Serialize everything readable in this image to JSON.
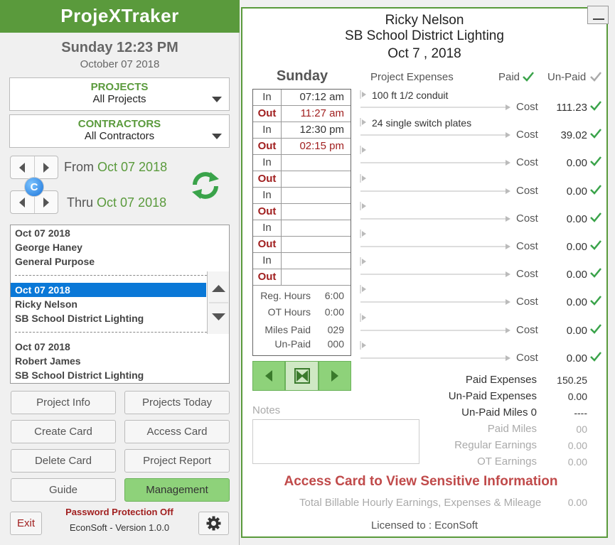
{
  "app": {
    "title": "ProjeXTraker"
  },
  "now": {
    "day_time": "Sunday 12:23 PM",
    "date": "October 07 2018"
  },
  "filters": {
    "projects_label": "PROJECTS",
    "projects_value": "All Projects",
    "contractors_label": "CONTRACTORS",
    "contractors_value": "All Contractors"
  },
  "range": {
    "from_label": "From",
    "from_date": "Oct 07 2018",
    "thru_label": "Thru",
    "thru_date": "Oct 07 2018",
    "clear_badge": "C"
  },
  "cards": [
    {
      "date": "Oct 07 2018",
      "name": "George Haney",
      "project": "General Purpose",
      "selected": false
    },
    {
      "date": "Oct 07 2018",
      "name": "Ricky Nelson",
      "project": "SB School District Lighting",
      "selected": true
    },
    {
      "date": "Oct 07 2018",
      "name": "Robert James",
      "project": "SB School District Lighting",
      "selected": false
    }
  ],
  "buttons": {
    "project_info": "Project Info",
    "projects_today": "Projects Today",
    "create_card": "Create Card",
    "access_card": "Access Card",
    "delete_card": "Delete Card",
    "project_report": "Project Report",
    "guide": "Guide",
    "management": "Management",
    "exit": "Exit"
  },
  "footer": {
    "password_status": "Password Protection Off",
    "version": "EconSoft - Version 1.0.0"
  },
  "card": {
    "name": "Ricky Nelson",
    "project": "SB School District Lighting",
    "date": "Oct 7 , 2018",
    "day": "Sunday",
    "times": [
      {
        "label": "In",
        "value": "07:12 am"
      },
      {
        "label": "Out",
        "value": "11:27 am"
      },
      {
        "label": "In",
        "value": "12:30 pm"
      },
      {
        "label": "Out",
        "value": "02:15 pm"
      },
      {
        "label": "In",
        "value": ""
      },
      {
        "label": "Out",
        "value": ""
      },
      {
        "label": "In",
        "value": ""
      },
      {
        "label": "Out",
        "value": ""
      },
      {
        "label": "In",
        "value": ""
      },
      {
        "label": "Out",
        "value": ""
      },
      {
        "label": "In",
        "value": ""
      },
      {
        "label": "Out",
        "value": ""
      }
    ],
    "hours": {
      "reg_label": "Reg. Hours",
      "reg_value": "6:00",
      "ot_label": "OT Hours",
      "ot_value": "0:00",
      "miles_paid_label": "Miles Paid",
      "miles_paid_value": "029",
      "miles_unpaid_label": "Un-Paid",
      "miles_unpaid_value": "000"
    },
    "expenses_header": {
      "title": "Project Expenses",
      "paid": "Paid",
      "unpaid": "Un-Paid"
    },
    "expenses": [
      {
        "desc": "100 ft 1/2 conduit",
        "cost_label": "Cost",
        "cost": "111.23"
      },
      {
        "desc": "24 single switch plates",
        "cost_label": "Cost",
        "cost": "39.02"
      },
      {
        "desc": "",
        "cost_label": "Cost",
        "cost": "0.00"
      },
      {
        "desc": "",
        "cost_label": "Cost",
        "cost": "0.00"
      },
      {
        "desc": "",
        "cost_label": "Cost",
        "cost": "0.00"
      },
      {
        "desc": "",
        "cost_label": "Cost",
        "cost": "0.00"
      },
      {
        "desc": "",
        "cost_label": "Cost",
        "cost": "0.00"
      },
      {
        "desc": "",
        "cost_label": "Cost",
        "cost": "0.00"
      },
      {
        "desc": "",
        "cost_label": "Cost",
        "cost": "0.00"
      },
      {
        "desc": "",
        "cost_label": "Cost",
        "cost": "0.00"
      }
    ],
    "summary": [
      {
        "label": "Paid Expenses",
        "value": "150.25",
        "dim": false
      },
      {
        "label": "Un-Paid Expenses",
        "value": "0.00",
        "dim": false
      },
      {
        "label": "Un-Paid Miles 0",
        "value": "----",
        "dim": false
      },
      {
        "label": "Paid Miles",
        "value": "00",
        "dim": true
      },
      {
        "label": "Regular Earnings",
        "value": "0.00",
        "dim": true
      },
      {
        "label": "OT Earnings",
        "value": "0.00",
        "dim": true
      }
    ],
    "notes_label": "Notes",
    "notes_value": "",
    "access_message": "Access Card to View Sensitive Information",
    "billable_label": "Total Billable Hourly Earnings, Expenses & Mileage",
    "billable_value": "0.00",
    "licensed": "Licensed to : EconSoft"
  },
  "colors": {
    "brand_green": "#5a9a3c",
    "button_green": "#8ed27a",
    "out_red": "#a12020",
    "access_red": "#c04a4a",
    "selection_blue": "#0a78d7"
  }
}
